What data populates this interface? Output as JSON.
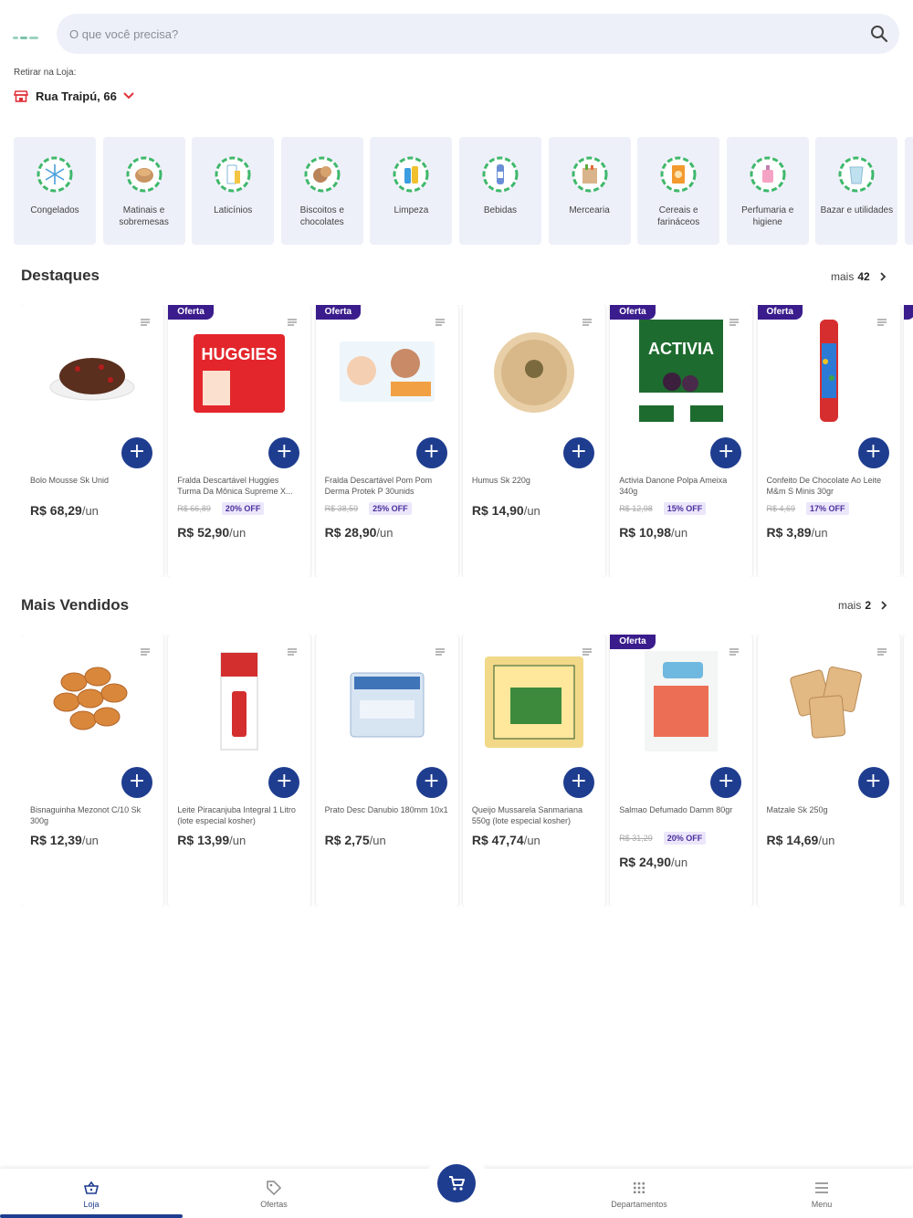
{
  "header": {
    "search_placeholder": "O que você precisa?",
    "pickup_label": "Retirar na Loja:",
    "store_name": "Rua Traipú, 66"
  },
  "categories": [
    {
      "label": "Congelados",
      "icon": "snowflake-icon"
    },
    {
      "label": "Matinais e sobremesas",
      "icon": "bread-icon"
    },
    {
      "label": "Laticínios",
      "icon": "milk-icon"
    },
    {
      "label": "Biscoitos e chocolates",
      "icon": "cookie-icon"
    },
    {
      "label": "Limpeza",
      "icon": "cleaning-icon"
    },
    {
      "label": "Bebidas",
      "icon": "bottle-icon"
    },
    {
      "label": "Mercearia",
      "icon": "grocery-bag-icon"
    },
    {
      "label": "Cereais e farináceos",
      "icon": "cereal-icon"
    },
    {
      "label": "Perfumaria e higiene",
      "icon": "perfume-icon"
    },
    {
      "label": "Bazar e utilidades",
      "icon": "cup-icon"
    }
  ],
  "sections": {
    "highlights": {
      "title": "Destaques",
      "more_label": "mais",
      "more_count": "42",
      "products": [
        {
          "name": "Bolo Mousse Sk Unid",
          "price": "R$ 68,29",
          "unit": "/un",
          "offer": "",
          "old_price": "",
          "discount": ""
        },
        {
          "name": "Fralda Descartável Huggies Turma Da Mônica Supreme X...",
          "price": "R$ 52,90",
          "unit": "/un",
          "offer": "Oferta",
          "old_price": "R$ 66,89",
          "discount": "20% OFF"
        },
        {
          "name": "Fralda Descartável Pom Pom Derma Protek P 30unids",
          "price": "R$ 28,90",
          "unit": "/un",
          "offer": "Oferta",
          "old_price": "R$ 38,59",
          "discount": "25% OFF"
        },
        {
          "name": "Humus Sk 220g",
          "price": "R$ 14,90",
          "unit": "/un",
          "offer": "",
          "old_price": "",
          "discount": ""
        },
        {
          "name": "Activia Danone Polpa Ameixa 340g",
          "price": "R$ 10,98",
          "unit": "/un",
          "offer": "Oferta",
          "old_price": "R$ 12,98",
          "discount": "15% OFF"
        },
        {
          "name": "Confeito De Chocolate Ao Leite M&m S Minis 30gr",
          "price": "R$ 3,89",
          "unit": "/un",
          "offer": "Oferta",
          "old_price": "R$ 4,69",
          "discount": "17% OFF"
        }
      ]
    },
    "best_sellers": {
      "title": "Mais Vendidos",
      "more_label": "mais",
      "more_count": "2",
      "products": [
        {
          "name": "Bisnaguinha Mezonot C/10 Sk 300g",
          "price": "R$ 12,39",
          "unit": "/un",
          "offer": "",
          "old_price": "",
          "discount": ""
        },
        {
          "name": "Leite Piracanjuba Integral 1 Litro (lote especial kosher)",
          "price": "R$ 13,99",
          "unit": "/un",
          "offer": "",
          "old_price": "",
          "discount": ""
        },
        {
          "name": "Prato Desc Danubio 180mm 10x1",
          "price": "R$ 2,75",
          "unit": "/un",
          "offer": "",
          "old_price": "",
          "discount": ""
        },
        {
          "name": "Queijo Mussarela Sanmariana 550g (lote especial kosher)",
          "price": "R$ 47,74",
          "unit": "/un",
          "offer": "",
          "old_price": "",
          "discount": ""
        },
        {
          "name": "Salmao Defumado Damm 80gr",
          "price": "R$ 24,90",
          "unit": "/un",
          "offer": "Oferta",
          "old_price": "R$ 31,29",
          "discount": "20% OFF"
        },
        {
          "name": "Matzale Sk 250g",
          "price": "R$ 14,69",
          "unit": "/un",
          "offer": "",
          "old_price": "",
          "discount": ""
        }
      ]
    }
  },
  "bottom_nav": {
    "items": [
      {
        "label": "Loja",
        "icon": "basket-icon"
      },
      {
        "label": "Ofertas",
        "icon": "tag-icon"
      },
      {
        "label": "Departamentos",
        "icon": "grid-icon"
      },
      {
        "label": "Menu",
        "icon": "menu-icon"
      }
    ],
    "active_index": 0
  },
  "colors": {
    "accent": "#1f3d8f",
    "badge": "#3a1c8c",
    "category_bg": "#eef0f9",
    "store_icon": "#e0303a",
    "icon_green": "#3fb86b"
  }
}
